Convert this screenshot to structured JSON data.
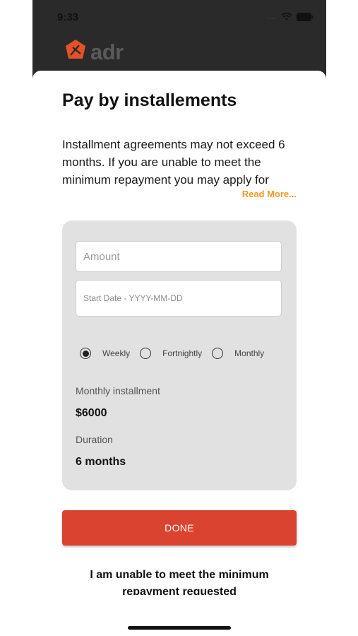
{
  "status_bar": {
    "time": "9:33",
    "signal": "....",
    "wifi_icon": "wifi-icon",
    "battery_icon": "battery-icon"
  },
  "brand": {
    "name": "adr",
    "logo_icon": "adr-logo-icon",
    "logo_color": "#e2522a"
  },
  "sheet": {
    "title": "Pay by installements",
    "description": "Installment agreements may not exceed 6 months. If you are unable to meet the minimum repayment you may apply for",
    "read_more": "Read More..."
  },
  "form": {
    "amount_placeholder": "Amount",
    "amount_value": "",
    "start_date_placeholder": "Start Date - YYYY-MM-DD",
    "start_date_value": "",
    "frequency_options": [
      "Weekly",
      "Fortnightly",
      "Monthly"
    ],
    "selected_frequency": "Weekly"
  },
  "summary": {
    "installment_label": "Monthly installment",
    "installment_value": "$6000",
    "duration_label": "Duration",
    "duration_value": "6 months"
  },
  "actions": {
    "done_label": "DONE",
    "unable_text": "I am unable to meet the minimum repayment requested"
  },
  "colors": {
    "accent_button": "#d9432f",
    "read_more": "#f29a1f",
    "card_background": "#e1e1e1"
  }
}
